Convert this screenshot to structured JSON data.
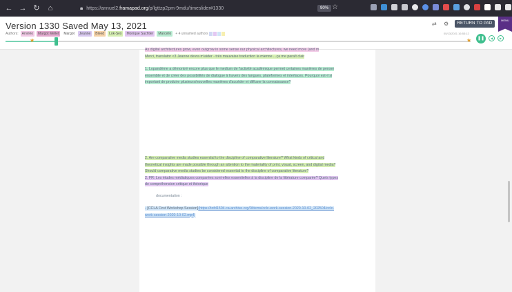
{
  "browser": {
    "url_prefix": "https://annuel2.",
    "url_host": "framapad.org",
    "url_path": "/p/lgttzp2pm-9mdu/timeslider#1330",
    "zoom": "90%"
  },
  "timeslider": {
    "title": "Version 1330 Saved May 13, 2021",
    "authors_label": "Authors:",
    "authors": [
      {
        "name": "Anviléo",
        "color": "#f2c9e6"
      },
      {
        "name": "Margot Mellet",
        "color": "#e3a9cf"
      },
      {
        "name": "Margot",
        "color": "#ffffff"
      },
      {
        "name": "Jeanne",
        "color": "#d9c9f0"
      },
      {
        "name": "Bleed",
        "color": "#f6d3a8"
      },
      {
        "name": "Lok-Sex",
        "color": "#d6efb2"
      },
      {
        "name": "Monique Sachtler",
        "color": "#e3c8f2"
      },
      {
        "name": "Marcello",
        "color": "#b9ecd2"
      }
    ],
    "unnamed_authors": "+ 4 unnamed authors",
    "unnamed_colors": [
      "#cfd8f3",
      "#e3c8f2",
      "#cfe4f7",
      "#f6efb0"
    ],
    "return_button": "RETURN TO PAD",
    "saved_date": "05/13/2021 16:53:12",
    "menu_badge": "MENU",
    "position_fraction": 0.11
  },
  "document": {
    "para1_a": "As digital architectures grow, even outgrow in some sense our physical architectures, we need more (and m",
    "para1_b": "Merci, translator <3 Jeanne devra m'aider - très mauvaise traduction la mienne ...ça me paraît clair",
    "para2_a": "1. Lopandème a démontré encore plus que le medium de l'activité académique permet certaines manières de penser",
    "para2_b": "ensemble et de créer des possibilités de dialogue à travers des langues, plateformes et interfaces. Pourquoi est-il si",
    "para2_c": "important de produire plusieurs/nouvelles manières d'accéder et diffuser la connaissance?",
    "para3_a": "2.  Are comparative media studies essential to the discipline of comparative literature? What kinds of critical and",
    "para3_b": "theoretical insights are made possible through an attention to the materiality of print, visual, screen, and digital media?",
    "para3_c": "Should comparative media studies be considered essential to the discipline of comparative literature?",
    "para3_d": "2. FR: Les études médiatiques comparées sont-elles essentielles à la discipline de la littérature comparée? Quels types",
    "para3_e": "de compréhension critique et théorique",
    "documentation": "documentation :",
    "cclia_label": "- [CCLA First Workshop Session]",
    "cclia_link_a": "(https://tofd1504.ca.archive.org/0/items/cclc-work-session-2020-10-02_202504/cclc-",
    "cclia_link_b": "work-session-2020-10-02.mp4)"
  }
}
